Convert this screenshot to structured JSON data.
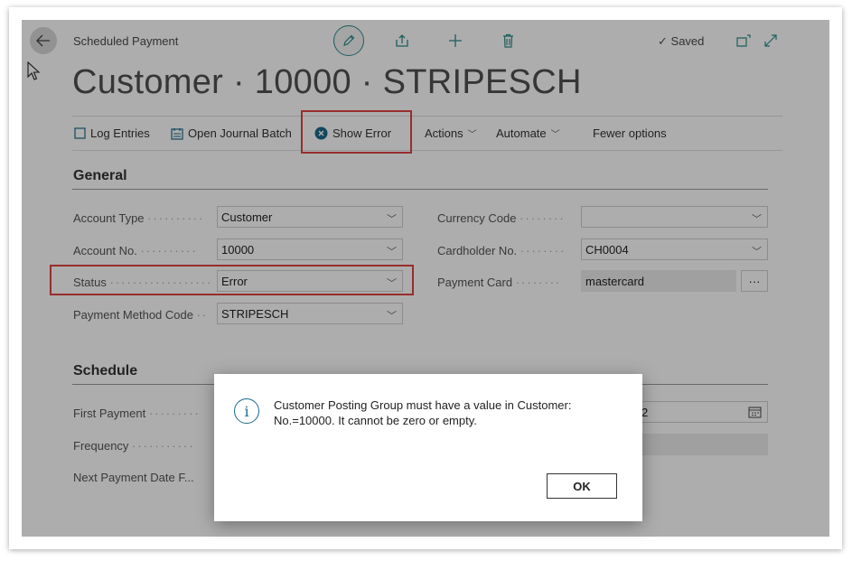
{
  "header": {
    "breadcrumb": "Scheduled Payment",
    "title": "Customer · 10000 · STRIPESCH",
    "saved_label": "Saved",
    "icons": [
      "back-arrow-icon",
      "edit-icon",
      "share-icon",
      "add-icon",
      "delete-icon",
      "checkmark-icon",
      "open-new-window-icon",
      "expand-icon"
    ]
  },
  "actions": {
    "log_entries": "Log Entries",
    "open_journal_batch": "Open Journal Batch",
    "show_error": "Show Error",
    "actions_menu": "Actions",
    "automate_menu": "Automate",
    "fewer_options": "Fewer options"
  },
  "general": {
    "title": "General",
    "left_fields": [
      {
        "label": "Account Type",
        "value": "Customer"
      },
      {
        "label": "Account No.",
        "value": "10000"
      },
      {
        "label": "Status",
        "value": "Error"
      },
      {
        "label": "Payment Method Code",
        "value": "STRIPESCH"
      }
    ],
    "right_fields": [
      {
        "label": "Currency Code",
        "value": ""
      },
      {
        "label": "Cardholder No.",
        "value": "CH0004"
      },
      {
        "label": "Payment Card",
        "value": "mastercard"
      }
    ],
    "more_button": "···"
  },
  "schedule": {
    "title": "Schedule",
    "fields": [
      {
        "label": "First Payment"
      },
      {
        "label": "Frequency"
      },
      {
        "label": "Next Payment Date F..."
      }
    ],
    "date_fragment": "2"
  },
  "dialog": {
    "message": "Customer Posting Group must have a value in Customer: No.=10000. It cannot be zero or empty.",
    "ok_label": "OK"
  },
  "colors": {
    "accent": "#2a8c8a",
    "highlight": "#e04343",
    "info": "#1a6a8a"
  }
}
